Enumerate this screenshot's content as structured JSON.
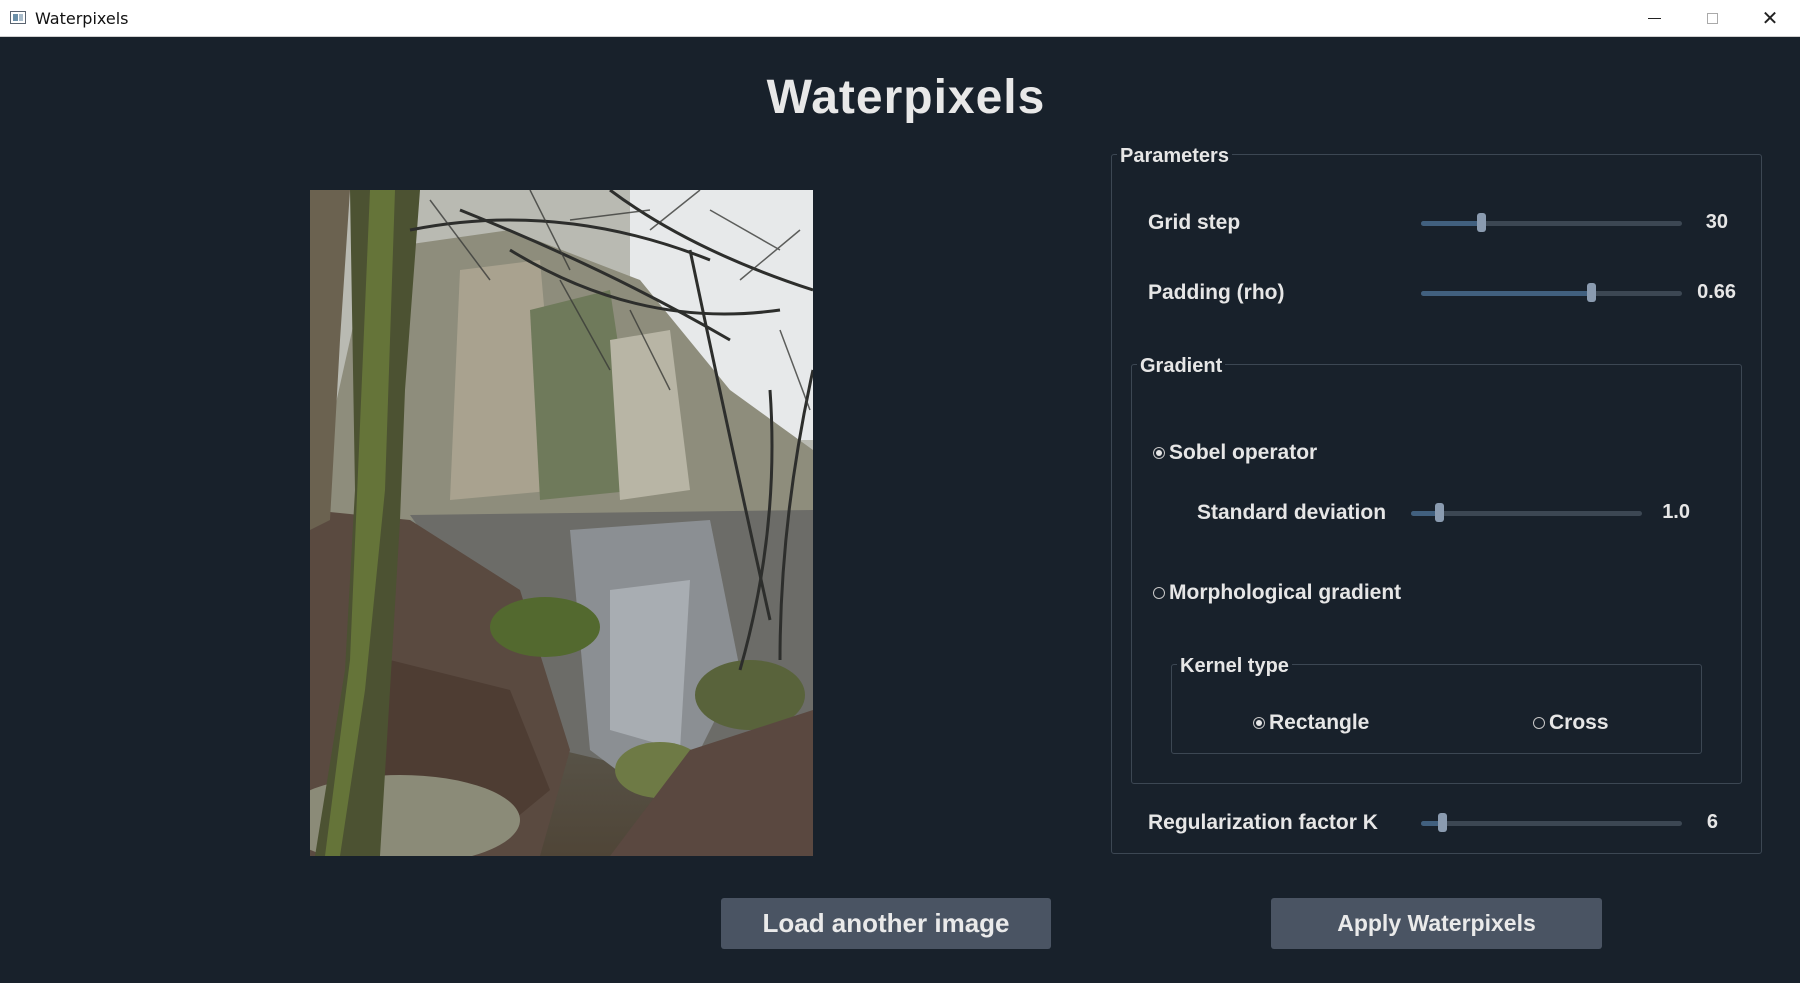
{
  "window": {
    "title": "Waterpixels",
    "app_icon": "app-window-icon"
  },
  "page": {
    "title": "Waterpixels"
  },
  "image": {
    "description_icon": "image-preview"
  },
  "parameters": {
    "group_title": "Parameters",
    "grid_step": {
      "label": "Grid step",
      "value": "30",
      "fraction": 0.23
    },
    "padding": {
      "label": "Padding (rho)",
      "value": "0.66",
      "fraction": 0.65
    },
    "gradient": {
      "group_title": "Gradient",
      "sobel": {
        "label": "Sobel operator",
        "checked": true
      },
      "std_dev": {
        "label": "Standard deviation",
        "value": "1.0",
        "fraction": 0.12
      },
      "morph": {
        "label": "Morphological gradient",
        "checked": false
      },
      "kernel": {
        "group_title": "Kernel type",
        "rectangle": {
          "label": "Rectangle",
          "checked": true
        },
        "cross": {
          "label": "Cross",
          "checked": false
        }
      }
    },
    "regularization": {
      "label": "Regularization factor K",
      "value": "6",
      "fraction": 0.08
    }
  },
  "buttons": {
    "load": "Load another image",
    "apply": "Apply Waterpixels"
  },
  "colors": {
    "background": "#18212b",
    "button": "#4a5463",
    "slider_fill": "#41607f"
  }
}
